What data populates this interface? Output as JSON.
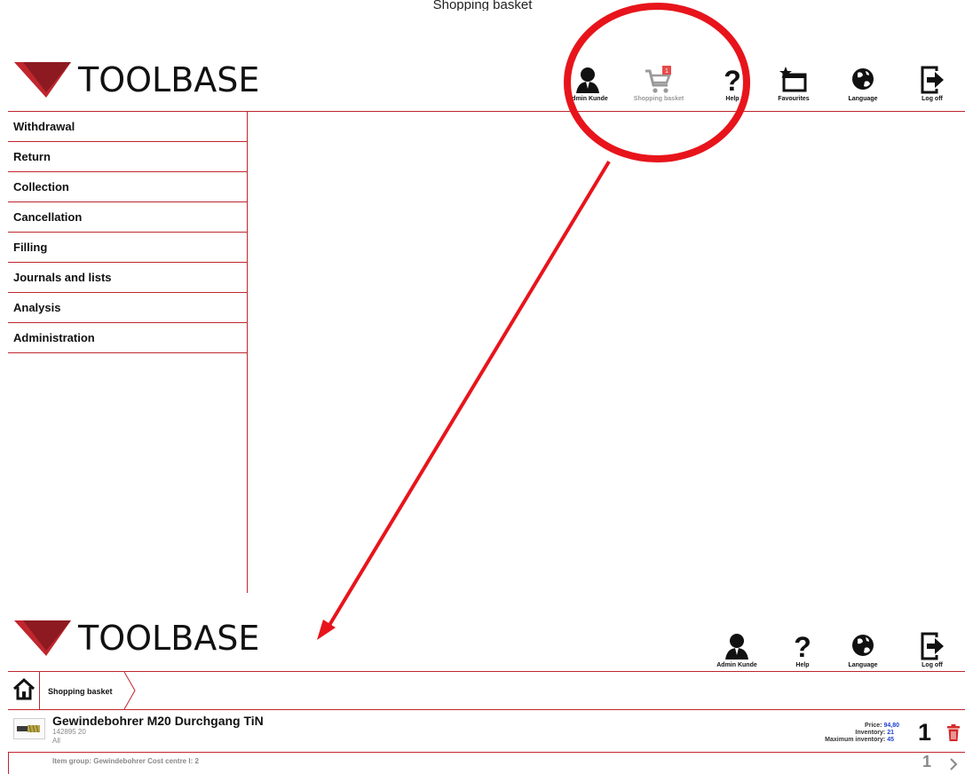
{
  "partial_top_text": "Shopping basket",
  "app": {
    "logo_text": "TOOLBASE"
  },
  "header": {
    "buttons": [
      {
        "label": "Admin Kunde",
        "icon": "user-icon"
      },
      {
        "label": "Shopping basket",
        "icon": "cart-icon",
        "badge": "1",
        "state": "disabled"
      },
      {
        "label": "Help",
        "icon": "help-icon"
      },
      {
        "label": "Favourites",
        "icon": "favourites-icon"
      },
      {
        "label": "Language",
        "icon": "globe-icon"
      },
      {
        "label": "Log off",
        "icon": "logoff-icon"
      }
    ]
  },
  "menu": {
    "items": [
      "Withdrawal",
      "Return",
      "Collection",
      "Cancellation",
      "Filling",
      "Journals and lists",
      "Analysis",
      "Administration"
    ]
  },
  "bottom": {
    "header_buttons": [
      {
        "label": "Admin Kunde",
        "icon": "user-icon"
      },
      {
        "label": "Help",
        "icon": "help-icon"
      },
      {
        "label": "Language",
        "icon": "globe-icon"
      },
      {
        "label": "Log off",
        "icon": "logoff-icon"
      }
    ],
    "breadcrumb": {
      "home_icon": "home-icon",
      "current": "Shopping basket"
    },
    "item": {
      "name": "Gewindebohrer M20 Durchgang TiN",
      "number": "142895 20",
      "scope": "All",
      "item_group": "Item group: Gewindebohrer  Cost centre I: 2",
      "price_label": "Price:",
      "price": "94,80",
      "inventory_label": "Inventory:",
      "inventory": "21",
      "max_inventory_label": "Maximum inventory:",
      "max_inventory": "45",
      "quantity": "1",
      "quantity_secondary": "1"
    }
  },
  "colors": {
    "accent": "#c0262e",
    "annotation": "#e8141b",
    "value_blue": "#1f3fd1"
  }
}
